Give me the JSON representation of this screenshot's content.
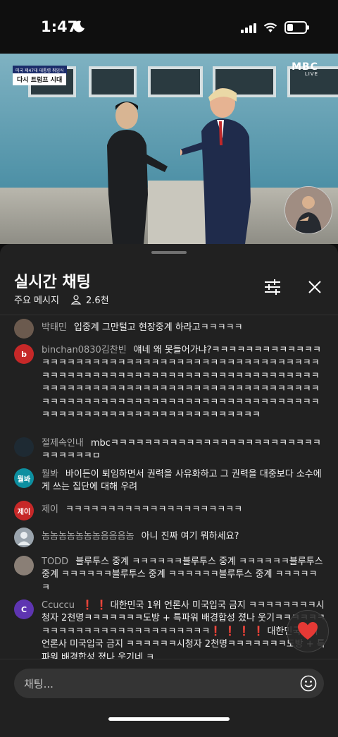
{
  "status_bar": {
    "time": "1:47"
  },
  "video": {
    "caption_top": "미국 제47대 대통령 취임식",
    "caption_main": "다시 트럼프 시대",
    "logo": "MBC",
    "logo_sub": "LIVE"
  },
  "chat_panel": {
    "title": "실시간 채팅",
    "subtitle": "주요 메시지",
    "viewer_count": "2.6천",
    "input_placeholder": "채팅..."
  },
  "messages": [
    {
      "author": "박태민",
      "text": "입중계 그만털고 현장중계 하라고ㅋㅋㅋㅋㅋ",
      "avatar_text": "",
      "avatar_color": "#6b5a4e"
    },
    {
      "author": "binchan0830김찬빈",
      "text": "얘네 왜 못들어가냐?ㅋㅋㅋㅋㅋㅋㅋㅋㅋㅋㅋㅋㅋㅋㅋㅋㅋㅋㅋㅋㅋㅋㅋㅋㅋㅋㅋㅋㅋㅋㅋㅋㅋㅋㅋㅋㅋㅋㅋㅋㅋㅋㅋㅋㅋㅋㅋㅋㅋㅋㅋㅋㅋㅋㅋㅋㅋㅋㅋㅋㅋㅋㅋㅋㅋㅋㅋㅋㅋㅋㅋㅋㅋㅋㅋㅋㅋㅋㅋㅋㅋㅋㅋㅋㅋㅋㅋㅋㅋㅋㅋㅋㅋㅋㅋㅋㅋㅋㅋㅋㅋㅋㅋㅋㅋㅋㅋㅋㅋㅋㅋㅋㅋㅋㅋㅋㅋㅋㅋㅋㅋㅋㅋㅋㅋㅋㅋㅋㅋㅋㅋㅋㅋㅋㅋㅋㅋㅋㅋㅋㅋㅋㅋㅋㅋㅋㅋㅋㅋㅋㅋㅋㅋㅋㅋㅋㅋㅋㅋㅋㅋㅋㅋㅋㅋㅋㅋㅋㅋㅋㅋ",
      "avatar_text": "b",
      "avatar_color": "#c62828"
    },
    {
      "author": "절제속인내",
      "text": "mbcㅋㅋㅋㅋㅋㅋㅋㅋㅋㅋㅋㅋㅋㅋㅋㅋㅋㅋㅋㅋㅋㅋㅋㅋㅋㅋㅋㅋㅋㅋㅋㅁ",
      "avatar_text": "",
      "avatar_color": "#1e2a33"
    },
    {
      "author": "뭘봐",
      "text": "바이든이 퇴임하면서 권력을 사유화하고 그 권력을 대중보다 소수에게 쓰는 집단에 대해 우려",
      "avatar_text": "뭘봐",
      "avatar_color": "#0d8fa0"
    },
    {
      "author": "제이",
      "text": "ㅋㅋㅋㅋㅋㅋㅋㅋㅋㅋㅋㅋㅋㅋㅋㅋㅋㅋㅋㅋㅋ",
      "avatar_text": "제이",
      "avatar_color": "#c62828"
    },
    {
      "author": "놈놈놈놈놈놈놈음음음놈",
      "text": "아니 진짜 여기 뭐하세요?",
      "avatar_text": "",
      "avatar_color": "#9aa4ad"
    },
    {
      "author": "TODD",
      "text": "블루투스 중계 ㅋㅋㅋㅋㅋㅋ블루투스 중계 ㅋㅋㅋㅋㅋㅋ블루투스 중계 ㅋㅋㅋㅋㅋㅋ블루투스 중계 ㅋㅋㅋㅋㅋㅋ블루투스 중계 ㅋㅋㅋㅋㅋㅋ",
      "avatar_text": "",
      "avatar_color": "#8a7f76"
    },
    {
      "author": "Ccuccu",
      "text": "❗ ❗ 대한민국 1위 언론사 미국입국 금지 ㅋㅋㅋㅋㅋㅋㅋㅋ시청자 2천명ㅋㅋㅋㅋㅋㅋㅋ도방 + 특파워 배경합성 졌나 웃기ㅋㅋㅋㅋㅋㅋㅋㅋㅋㅋㅋㅋㅋㅋㅋㅋㅋㅋㅋㅋㅋㅋㅋㅋㅋㅋ❗ ❗ ❗ ❗ 대한민국 1위 언론사 미국입국 금지 ㅋㅋㅋㅋㅋㅋ시청자 2천명ㅋㅋㅋㅋㅋㅋㅋ도방 + 특파워 배경합성 졌나 웃기네 ㅋ",
      "avatar_text": "C",
      "avatar_color": "#5e35b1"
    }
  ],
  "icons": {
    "filter": "filter-sliders-icon",
    "close": "close-icon",
    "emoji": "emoji-smile-icon",
    "heart": "heart-icon"
  }
}
